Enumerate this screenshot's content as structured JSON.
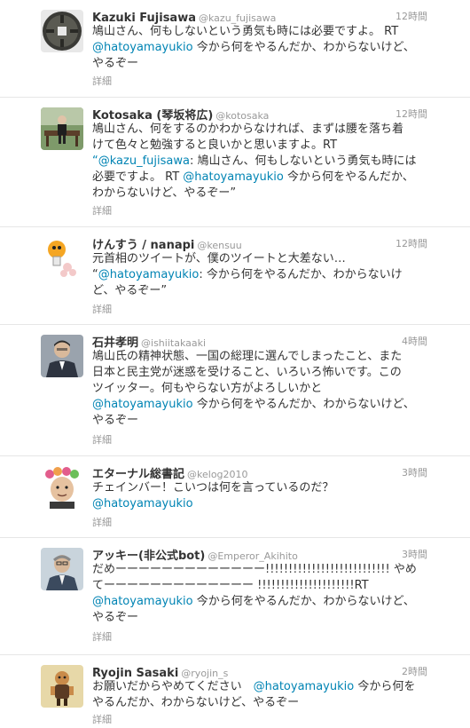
{
  "tweets": [
    {
      "name": "Kazuki Fujisawa",
      "handle": "@kazu_fujisawa",
      "time": "12時間",
      "lines": [
        [
          {
            "t": "鳩山さん、何もしないという勇気も時には必要ですよ。 RT",
            "m": false
          }
        ],
        [
          {
            "t": "@hatoyamayukio",
            "m": true
          },
          {
            "t": " 今から何をやるんだか、わからないけど、",
            "m": false
          }
        ],
        [
          {
            "t": "やるぞー",
            "m": false
          }
        ]
      ],
      "details": "詳細",
      "avatar": "coin-icon"
    },
    {
      "name": "Kotosaka (琴坂将広)",
      "handle": "@kotosaka",
      "time": "12時間",
      "lines": [
        [
          {
            "t": "鳩山さん、何をするのかわからなければ、まずは腰を落ち着",
            "m": false
          }
        ],
        [
          {
            "t": "けて色々と勉強すると良いかと思いますよ。RT",
            "m": false
          }
        ],
        [
          {
            "t": "“",
            "m": false
          },
          {
            "t": "@kazu_fujisawa",
            "m": true
          },
          {
            "t": ": 鳩山さん、何もしないという勇気も時には",
            "m": false
          }
        ],
        [
          {
            "t": "必要ですよ。 RT ",
            "m": false
          },
          {
            "t": "@hatoyamayukio",
            "m": true
          },
          {
            "t": " 今から何をやるんだか、",
            "m": false
          }
        ],
        [
          {
            "t": "わからないけど、やるぞー”",
            "m": false
          }
        ]
      ],
      "details": "詳細",
      "avatar": "person-on-bench-photo"
    },
    {
      "name": "けんすう / nanapi",
      "handle": "@kensuu",
      "time": "12時間",
      "lines": [
        [
          {
            "t": "元首相のツイートが、僕のツイートと大差ない…",
            "m": false
          }
        ],
        [
          {
            "t": "“",
            "m": false
          },
          {
            "t": "@hatoyamayukio",
            "m": true
          },
          {
            "t": ": 今から何をやるんだか、わからないけ",
            "m": false
          }
        ],
        [
          {
            "t": "ど、やるぞー”",
            "m": false
          }
        ]
      ],
      "details": "詳細",
      "avatar": "rocket-mascot-icon"
    },
    {
      "name": "石井孝明",
      "handle": "@ishiitakaaki",
      "time": "4時間",
      "lines": [
        [
          {
            "t": "鳩山氏の精神状態、一国の総理に選んでしまったこと、また",
            "m": false
          }
        ],
        [
          {
            "t": "日本と民主党が迷惑を受けること、いろいろ怖いです。この",
            "m": false
          }
        ],
        [
          {
            "t": "ツイッター。何もやらない方がよろしいかと",
            "m": false
          }
        ],
        [
          {
            "t": "@hatoyamayukio",
            "m": true
          },
          {
            "t": " 今から何をやるんだか、わからないけど、",
            "m": false
          }
        ],
        [
          {
            "t": "やるぞー",
            "m": false
          }
        ]
      ],
      "details": "詳細",
      "avatar": "man-in-suit-photo"
    },
    {
      "name": "エターナル総書記",
      "handle": "@kelog2010",
      "time": "3時間",
      "lines": [
        [
          {
            "t": "チェインバー！こいつは何を言っているのだ？",
            "m": false
          }
        ],
        [
          {
            "t": "@hatoyamayukio",
            "m": true
          }
        ]
      ],
      "details": "詳細",
      "avatar": "flower-crown-portrait"
    },
    {
      "name": "アッキー(非公式bot)",
      "handle": "@Emperor_Akihito",
      "time": "3時間",
      "lines": [
        [
          {
            "t": "だめーーーーーーーーーーーーー!!!!!!!!!!!!!!!!!!!!!!!!!!! やめ",
            "m": false
          }
        ],
        [
          {
            "t": "てーーーーーーーーーーーーー !!!!!!!!!!!!!!!!!!!!!RT",
            "m": false
          }
        ],
        [
          {
            "t": "@hatoyamayukio",
            "m": true
          },
          {
            "t": " 今から何をやるんだか、わからないけど、",
            "m": false
          }
        ],
        [
          {
            "t": "やるぞー",
            "m": false
          }
        ]
      ],
      "details": "詳細",
      "avatar": "elderly-man-photo"
    },
    {
      "name": "Ryojin Sasaki",
      "handle": "@ryojin_s",
      "time": "2時間",
      "lines": [
        [
          {
            "t": "お願いだからやめてください　",
            "m": false
          },
          {
            "t": "@hatoyamayukio",
            "m": true
          },
          {
            "t": " 今から何を",
            "m": false
          }
        ],
        [
          {
            "t": "やるんだか、わからないけど、やるぞー",
            "m": false
          }
        ]
      ],
      "details": "詳細",
      "avatar": "cartoon-figure-icon"
    }
  ],
  "colors": {
    "mention": "#0084b4",
    "meta": "#999999",
    "divider": "#e6e6e6"
  }
}
